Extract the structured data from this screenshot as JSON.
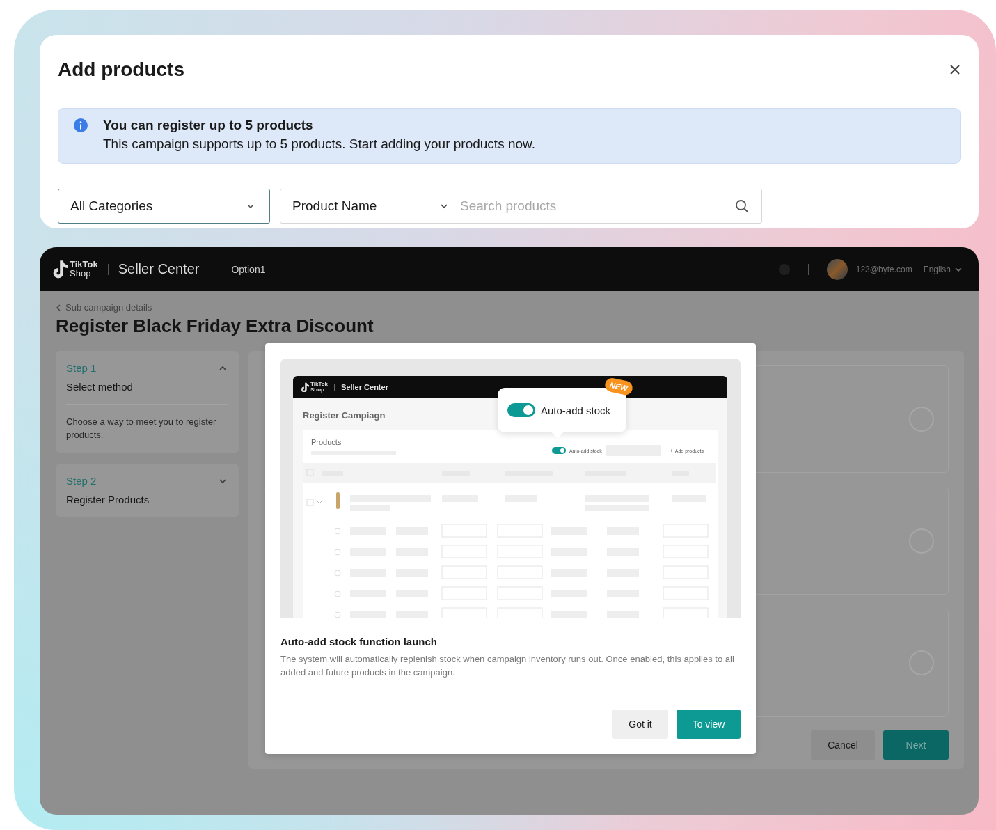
{
  "add_products_dialog": {
    "title": "Add products",
    "notice": {
      "title": "You can register up to 5 products",
      "body": "This campaign supports up to 5 products. Start adding your products now."
    },
    "filters": {
      "category": {
        "value": "All Categories"
      },
      "search_by": {
        "value": "Product Name"
      },
      "search": {
        "placeholder": "Search products"
      }
    }
  },
  "seller_center": {
    "logo_lines": [
      "TikTok",
      "Shop"
    ],
    "title": "Seller Center",
    "nav": [
      "Option1"
    ],
    "account": {
      "email": "123@byte.com",
      "language": "English"
    },
    "breadcrumb": "Sub campaign details",
    "page_title": "Register Black Friday Extra Discount",
    "steps": [
      {
        "label": "Step 1",
        "title": "Select method",
        "description": "Choose a way to meet you to register products.",
        "expanded": true
      },
      {
        "label": "Step 2",
        "title": "Register Products",
        "expanded": false
      }
    ],
    "options": [
      {
        "selected": false
      },
      {
        "selected": false
      },
      {
        "selected": false
      }
    ],
    "buttons": [
      {
        "label": "Cancel",
        "kind": "secondary"
      },
      {
        "label": "Next",
        "kind": "primary"
      }
    ]
  },
  "announcement": {
    "preview": {
      "logo_lines": [
        "TikTok",
        "Shop"
      ],
      "title": "Seller Center",
      "page_title": "Register Campiagn",
      "section": "Products",
      "toggle": {
        "label": "Auto-add stock",
        "on": true
      },
      "add_button": {
        "icon": "+",
        "label": "Add products"
      },
      "callout": {
        "label": "Auto-add stock",
        "on": true,
        "badge": "NEW"
      }
    },
    "title": "Auto-add stock function launch",
    "body": "The system will automatically replenish stock when campaign inventory runs out. Once enabled, this applies to all added and future products in the campaign.",
    "buttons": [
      {
        "label": "Got it",
        "kind": "secondary"
      },
      {
        "label": "To view",
        "kind": "primary"
      }
    ]
  }
}
